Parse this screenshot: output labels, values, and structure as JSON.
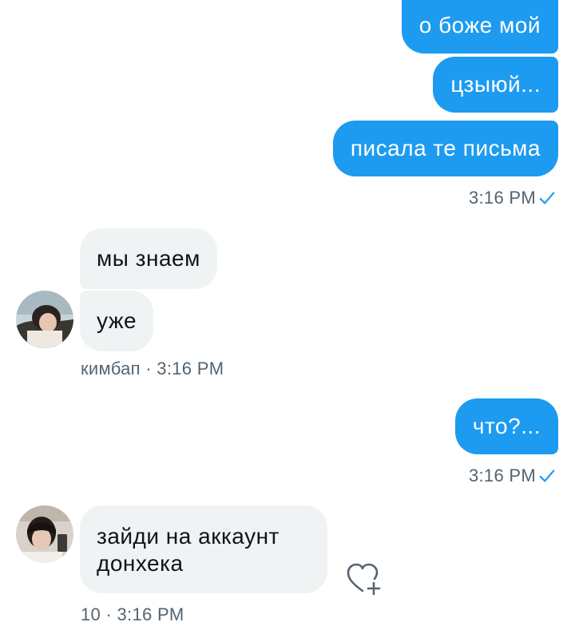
{
  "colors": {
    "outgoing_bubble": "#1d9bf0",
    "incoming_bubble": "#eff3f4",
    "meta_text": "#536471",
    "checkmark": "#1d9bf0"
  },
  "messages": {
    "out_1": "о боже мой",
    "out_2": "цзыюй...",
    "out_3": "писала те письма",
    "out_group1_time": "3:16 PM",
    "in_1": "мы знаем",
    "in_2": "уже",
    "in_group1_meta": "кимбап · 3:16 PM",
    "out_4": "что?...",
    "out_group2_time": "3:16 PM",
    "in_3_line1": "зайди на аккаунт",
    "in_3_line2": "донхека",
    "in_group2_meta": "10 · 3:16 PM"
  },
  "icons": {
    "sent_status": "checkmark-icon",
    "react": "heart-plus-icon"
  }
}
